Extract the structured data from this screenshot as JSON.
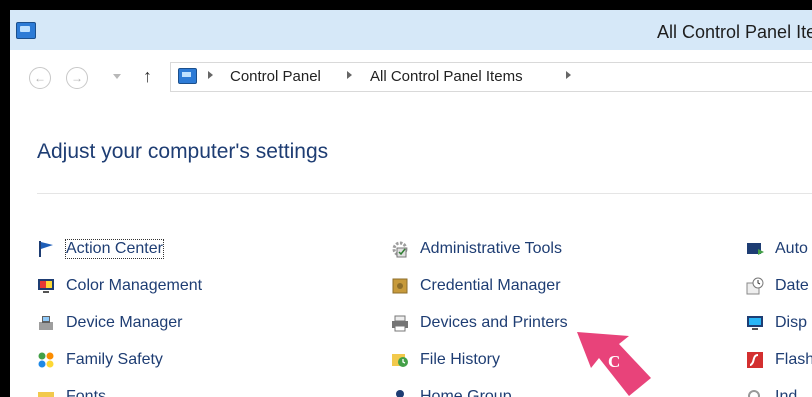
{
  "window": {
    "title": "All Control Panel Items"
  },
  "navigation": {
    "back_glyph": "←",
    "forward_glyph": "→",
    "up_glyph": "↑",
    "breadcrumb": [
      "Control Panel",
      "All Control Panel Items"
    ]
  },
  "main": {
    "heading": "Adjust your computer's settings"
  },
  "items": {
    "col1": [
      "Action Center",
      "Color Management",
      "Device Manager",
      "Family Safety",
      "Fonts"
    ],
    "col2": [
      "Administrative Tools",
      "Credential Manager",
      "Devices and Printers",
      "File History",
      "Home Group"
    ],
    "col3": [
      "Auto",
      "Date",
      "Disp",
      "Flash",
      "Ind"
    ]
  },
  "annotation": {
    "label": "C",
    "color": "#e8437a"
  }
}
